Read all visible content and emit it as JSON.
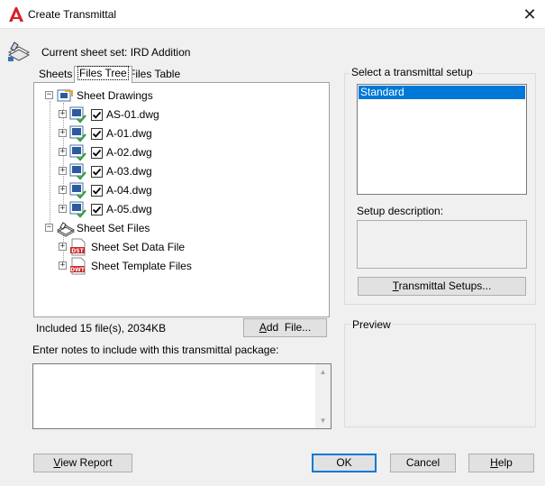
{
  "window": {
    "title": "Create Transmittal",
    "close_glyph": "✕"
  },
  "sheet_set": {
    "label": "Current sheet set: IRD Addition"
  },
  "tabs": [
    {
      "label": "Sheets",
      "selected": false
    },
    {
      "label": "Files Tree",
      "selected": true
    },
    {
      "label": "Files Table",
      "selected": false
    }
  ],
  "tree": {
    "sheet_drawings": {
      "label": "Sheet Drawings",
      "expander": "−",
      "items": [
        {
          "label": "AS-01.dwg",
          "checked": true,
          "expander": "+"
        },
        {
          "label": "A-01.dwg",
          "checked": true,
          "expander": "+"
        },
        {
          "label": "A-02.dwg",
          "checked": true,
          "expander": "+"
        },
        {
          "label": "A-03.dwg",
          "checked": true,
          "expander": "+"
        },
        {
          "label": "A-04.dwg",
          "checked": true,
          "expander": "+"
        },
        {
          "label": "A-05.dwg",
          "checked": true,
          "expander": "+"
        }
      ]
    },
    "sheet_set_files": {
      "label": "Sheet Set Files",
      "expander": "−",
      "items": [
        {
          "label": "Sheet Set Data File",
          "icon_text": "DST",
          "expander": "+"
        },
        {
          "label": "Sheet Template Files",
          "icon_text": "DWT",
          "expander": "+"
        }
      ]
    }
  },
  "included": {
    "text": "Included 15 file(s), 2034KB"
  },
  "buttons": {
    "add_file": {
      "mnemonic": "A",
      "rest": "dd  File..."
    },
    "transmittal_setups": {
      "mnemonic": "T",
      "rest": "ransmittal Setups..."
    },
    "view_report": {
      "mnemonic": "V",
      "rest": "iew Report"
    },
    "ok": "OK",
    "cancel": "Cancel",
    "help": {
      "mnemonic": "H",
      "rest": "elp"
    }
  },
  "notes": {
    "label": "Enter notes to include with this transmittal package:",
    "value": ""
  },
  "setup": {
    "group_label": "Select a transmittal setup",
    "items": [
      {
        "label": "Standard",
        "selected": true
      }
    ],
    "description_label": "Setup description:",
    "description_value": ""
  },
  "preview": {
    "label": "Preview"
  },
  "colors": {
    "accent": "#0078d7",
    "window_bg": "#f0f0f0",
    "autocad_red": "#d81e2c"
  }
}
